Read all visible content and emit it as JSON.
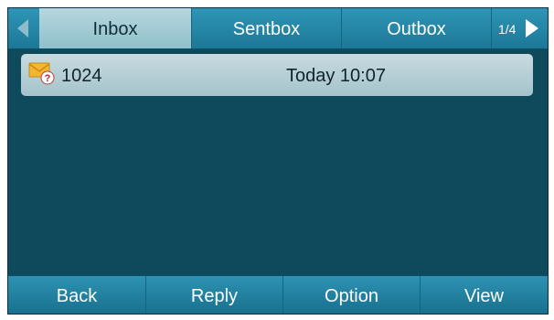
{
  "tabs": [
    {
      "label": "Inbox",
      "active": true
    },
    {
      "label": "Sentbox",
      "active": false
    },
    {
      "label": "Outbox",
      "active": false
    }
  ],
  "pagination": {
    "label": "1/4",
    "prev_icon": "triangle-left-icon",
    "next_icon": "triangle-right-icon"
  },
  "messages": [
    {
      "icon": "unread-envelope-icon",
      "sender": "1024",
      "time": "Today 10:07"
    }
  ],
  "softkeys": [
    {
      "label": "Back"
    },
    {
      "label": "Reply"
    },
    {
      "label": "Option"
    },
    {
      "label": "View"
    }
  ],
  "colors": {
    "background": "#0f4a5c",
    "bar": "#2a8fb0",
    "active_tab": "#a9cfd8",
    "row": "#b8d2d9"
  }
}
